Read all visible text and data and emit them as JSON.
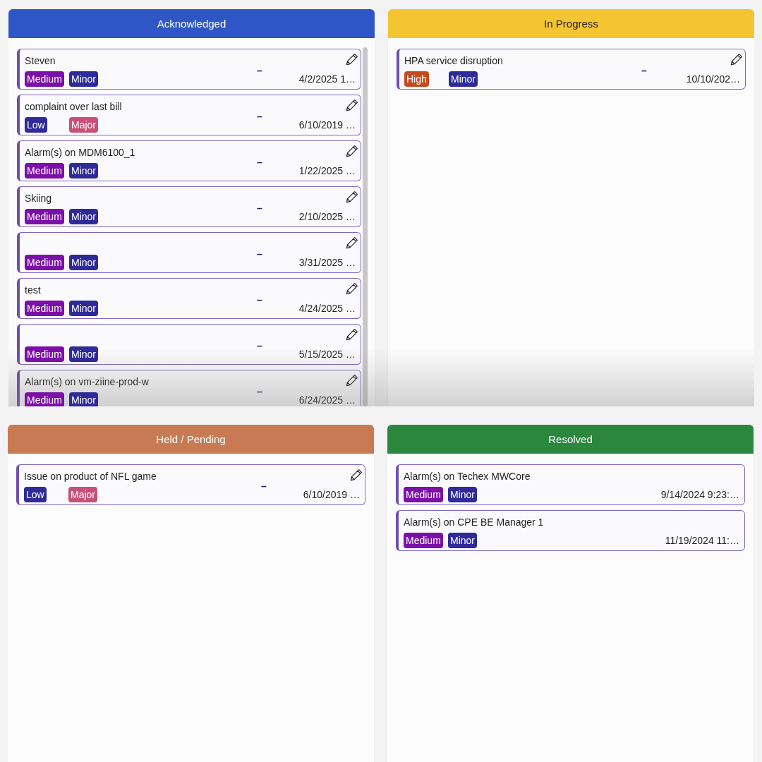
{
  "rows": [
    {
      "fade": true,
      "columns": [
        {
          "title": "Acknowledged",
          "color": "#2e56c6",
          "scrollbar": true,
          "cards": [
            {
              "title": "Steven",
              "tags": [
                {
                  "label": "Medium",
                  "color": "#7b0fa8"
                },
                {
                  "label": "Minor",
                  "color": "#2e2a99"
                }
              ],
              "dash": "–",
              "date": "4/2/2025 1…",
              "editable": true
            },
            {
              "title": "complaint over last bill",
              "tags": [
                {
                  "label": "Low",
                  "color": "#2e2a99"
                },
                {
                  "label": "Major",
                  "color": "#c74f78"
                }
              ],
              "dash": "–",
              "date": "6/10/2019 …",
              "editable": true
            },
            {
              "title": "Alarm(s) on MDM6100_1",
              "tags": [
                {
                  "label": "Medium",
                  "color": "#7b0fa8"
                },
                {
                  "label": "Minor",
                  "color": "#2e2a99"
                }
              ],
              "dash": "–",
              "date": "1/22/2025 …",
              "editable": true
            },
            {
              "title": "Skiing",
              "tags": [
                {
                  "label": "Medium",
                  "color": "#7b0fa8"
                },
                {
                  "label": "Minor",
                  "color": "#2e2a99"
                }
              ],
              "dash": "–",
              "date": "2/10/2025 …",
              "editable": true
            },
            {
              "tags": [
                {
                  "label": "Medium",
                  "color": "#7b0fa8"
                },
                {
                  "label": "Minor",
                  "color": "#2e2a99"
                }
              ],
              "dash": "–",
              "date": "3/31/2025 …",
              "editable": true
            },
            {
              "title": "test",
              "tags": [
                {
                  "label": "Medium",
                  "color": "#7b0fa8"
                },
                {
                  "label": "Minor",
                  "color": "#2e2a99"
                }
              ],
              "dash": "–",
              "date": "4/24/2025 …",
              "editable": true
            },
            {
              "tags": [
                {
                  "label": "Medium",
                  "color": "#7b0fa8"
                },
                {
                  "label": "Minor",
                  "color": "#2e2a99"
                }
              ],
              "dash": "–",
              "date": "5/15/2025 …",
              "editable": true
            },
            {
              "title": "Alarm(s) on vm-ziine-prod-w",
              "tags": [
                {
                  "label": "Medium",
                  "color": "#7b0fa8"
                },
                {
                  "label": "Minor",
                  "color": "#2e2a99"
                }
              ],
              "dash": "–",
              "date": "6/24/2025 …",
              "editable": true
            }
          ]
        },
        {
          "title": "In Progress",
          "color": "#f5c431",
          "scrollbar": false,
          "cards": [
            {
              "title": "HPA service disruption",
              "tags": [
                {
                  "label": "High",
                  "color": "#c64a1d"
                },
                {
                  "label": "Minor",
                  "color": "#2e2a99"
                }
              ],
              "dash": "–",
              "date": "10/10/202…",
              "editable": true
            }
          ]
        }
      ]
    },
    {
      "columns": [
        {
          "title": "Held / Pending",
          "color": "#c87b52",
          "scrollbar": false,
          "cards": [
            {
              "title": "Issue on product of NFL game",
              "tags": [
                {
                  "label": "Low",
                  "color": "#2e2a99"
                },
                {
                  "label": "Major",
                  "color": "#c74f78"
                }
              ],
              "dash": "–",
              "date": "6/10/2019 …",
              "editable": true
            }
          ]
        },
        {
          "title": "Resolved",
          "color": "#2a873d",
          "scrollbar": false,
          "cards": [
            {
              "title": "Alarm(s) on Techex MWCore",
              "tags": [
                {
                  "label": "Medium",
                  "color": "#7b0fa8"
                },
                {
                  "label": "Minor",
                  "color": "#2e2a99"
                }
              ],
              "date": "9/14/2024 9:23:…",
              "editable": false
            },
            {
              "title": "Alarm(s) on CPE BE Manager 1",
              "tags": [
                {
                  "label": "Medium",
                  "color": "#7b0fa8"
                },
                {
                  "label": "Minor",
                  "color": "#2e2a99"
                }
              ],
              "date": "11/19/2024 11:…",
              "editable": false
            }
          ]
        }
      ]
    }
  ]
}
